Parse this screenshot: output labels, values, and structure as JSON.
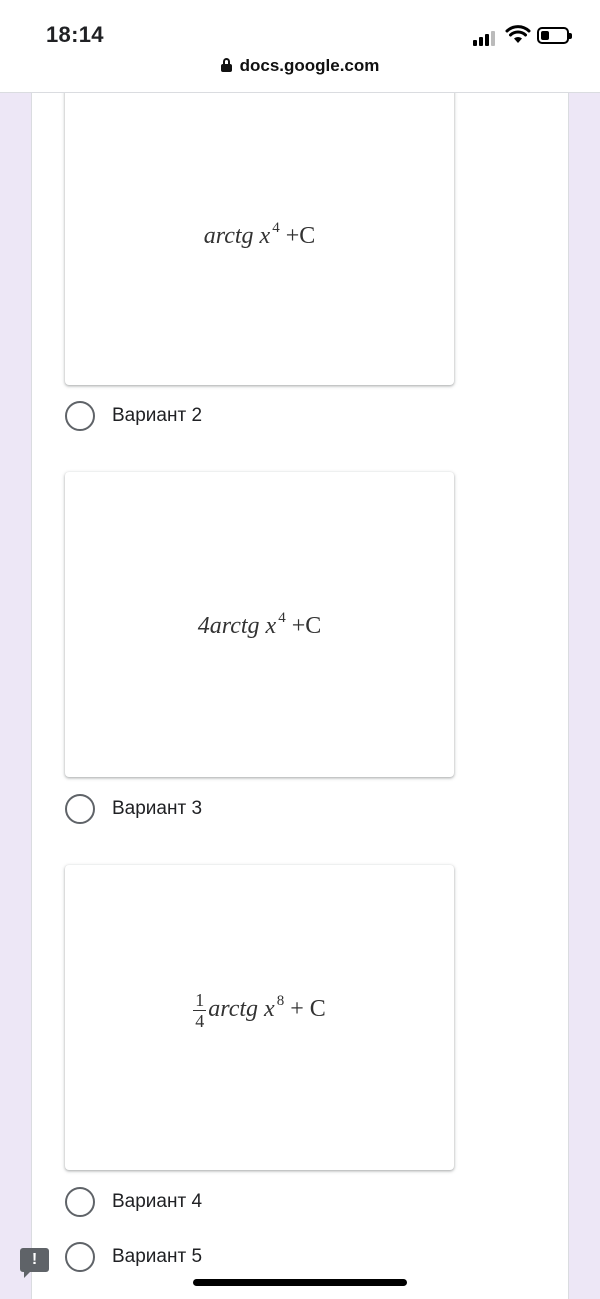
{
  "status": {
    "time": "18:14"
  },
  "browser": {
    "url": "docs.google.com"
  },
  "images": [
    {
      "formula_main": "arctg x",
      "formula_exp": "4",
      "formula_tail": "+C"
    },
    {
      "formula_prefix": "4",
      "formula_main": "arctg x",
      "formula_exp": "4",
      "formula_tail": "+C"
    },
    {
      "fraction_num": "1",
      "fraction_den": "4",
      "formula_main": "arctg x",
      "formula_exp": "8",
      "formula_tail": "+ C"
    }
  ],
  "options": [
    {
      "label": "Вариант 2"
    },
    {
      "label": "Вариант 3"
    },
    {
      "label": "Вариант 4"
    },
    {
      "label": "Вариант 5"
    }
  ],
  "feedback": {
    "icon": "!"
  }
}
